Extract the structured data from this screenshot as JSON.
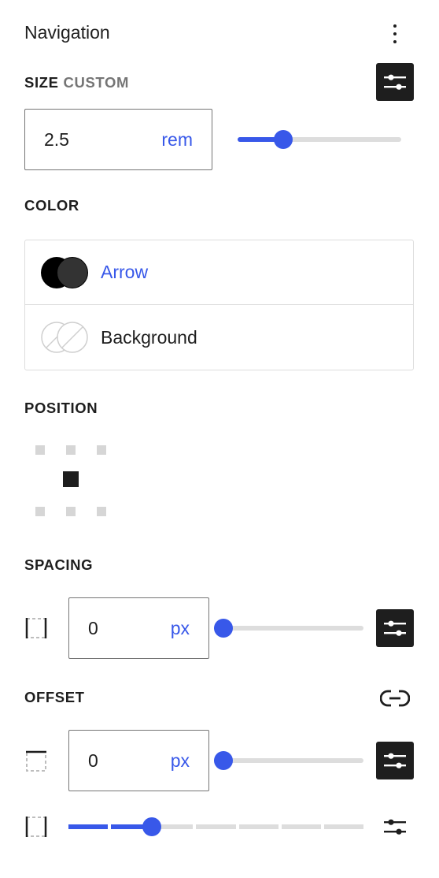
{
  "panel": {
    "title": "Navigation",
    "menu_icon": "more-vertical-icon"
  },
  "size": {
    "label": "SIZE",
    "sublabel": "CUSTOM",
    "value": "2.5",
    "unit": "rem",
    "slider_fraction": 0.25,
    "toggle_icon": "settings-sliders-icon"
  },
  "color": {
    "label": "COLOR",
    "items": [
      {
        "label": "Arrow",
        "swatch_icon": "color-swatch-dark-icon",
        "colors": [
          "#000000",
          "#333333"
        ]
      },
      {
        "label": "Background",
        "swatch_icon": "color-swatch-none-icon",
        "colors": []
      }
    ]
  },
  "position": {
    "label": "POSITION",
    "selected": "center",
    "options": [
      "top-left",
      "top-center",
      "top-right",
      "center-left",
      "center",
      "center-right",
      "bottom-left",
      "bottom-center",
      "bottom-right"
    ]
  },
  "spacing": {
    "label": "SPACING",
    "value": "0",
    "unit": "px",
    "slider_fraction": 0,
    "side_icon": "sides-horizontal-icon",
    "toggle_icon": "settings-sliders-icon"
  },
  "offset": {
    "label": "OFFSET",
    "link_icon": "unlink-icon",
    "top": {
      "value": "0",
      "unit": "px",
      "slider_fraction": 0,
      "side_icon": "side-top-icon",
      "toggle_icon": "settings-sliders-icon"
    },
    "horizontal": {
      "steps_total": 7,
      "steps_filled": 2,
      "side_icon": "sides-horizontal-icon",
      "toggle_icon": "settings-sliders-icon"
    }
  },
  "colors": {
    "accent": "#3858e9",
    "text": "#1e1e1e",
    "muted": "#757575",
    "border": "#dddddd"
  }
}
